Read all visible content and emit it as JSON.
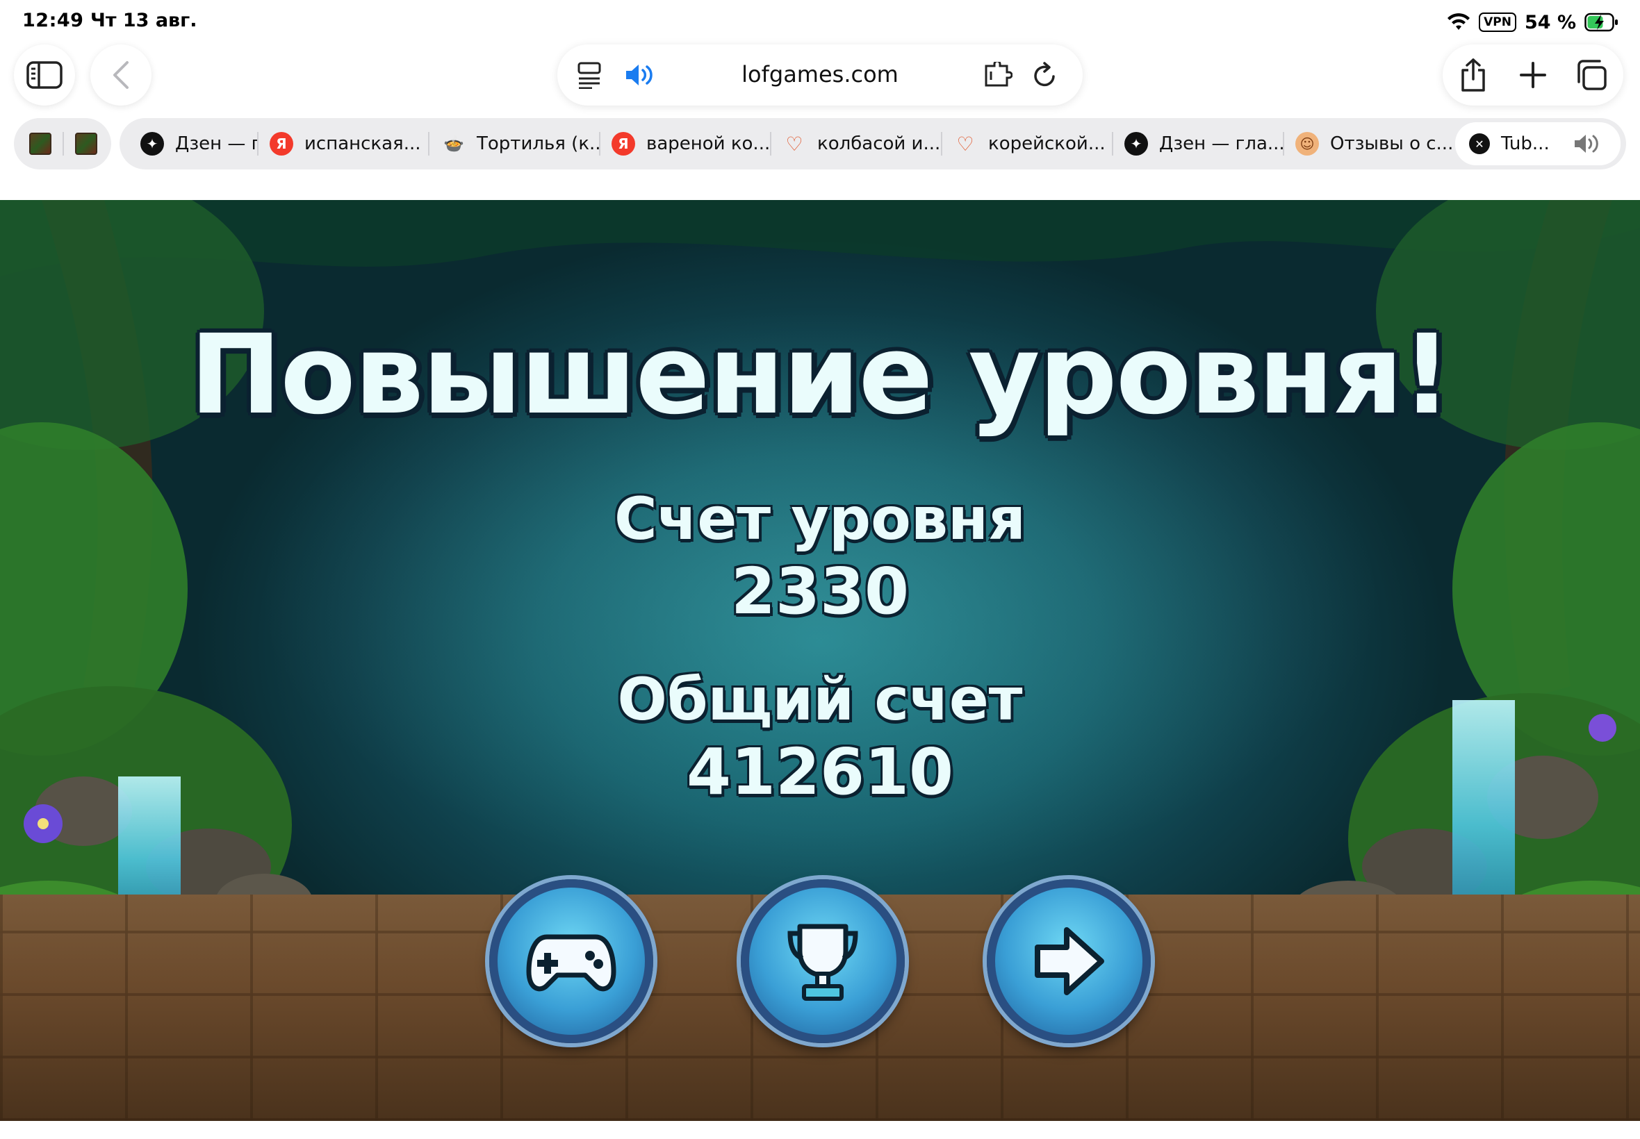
{
  "status_bar": {
    "time": "12:49",
    "date": "Чт 13 авг.",
    "vpn": "VPN",
    "battery": "54 %"
  },
  "address_bar": {
    "url": "lofgames.com"
  },
  "tabs": [
    {
      "label": "Дзен — гл",
      "favicon": "dzen-icon",
      "color": "#111111",
      "glyph": "✦"
    },
    {
      "label": "испанская...",
      "favicon": "yandex-icon",
      "color": "#f33a2b",
      "glyph": "Я"
    },
    {
      "label": "Тортилья (к...",
      "favicon": "recipe-icon",
      "color": "#e9a23b",
      "glyph": "🍲"
    },
    {
      "label": "вареной ко...",
      "favicon": "yandex-icon",
      "color": "#f33a2b",
      "glyph": "Я"
    },
    {
      "label": "колбасой и...",
      "favicon": "heart-icon",
      "color": "#ffffff",
      "glyph": "♡"
    },
    {
      "label": "корейской...",
      "favicon": "heart-icon",
      "color": "#ffffff",
      "glyph": "♡"
    },
    {
      "label": "Дзен — гла...",
      "favicon": "dzen-icon",
      "color": "#111111",
      "glyph": "✦"
    },
    {
      "label": "Отзывы о с...",
      "favicon": "avatar-icon",
      "color": "#ffffff",
      "glyph": "☺"
    },
    {
      "label": "Tub...",
      "favicon": "close-icon",
      "color": "#111111",
      "glyph": "✕"
    }
  ],
  "game": {
    "title": "Повышение уровня!",
    "level_score_label": "Счет уровня",
    "level_score": "2330",
    "total_score_label": "Общий счет",
    "total_score": "412610",
    "buttons": [
      "gamepad-icon",
      "trophy-icon",
      "arrow-right-icon"
    ]
  }
}
